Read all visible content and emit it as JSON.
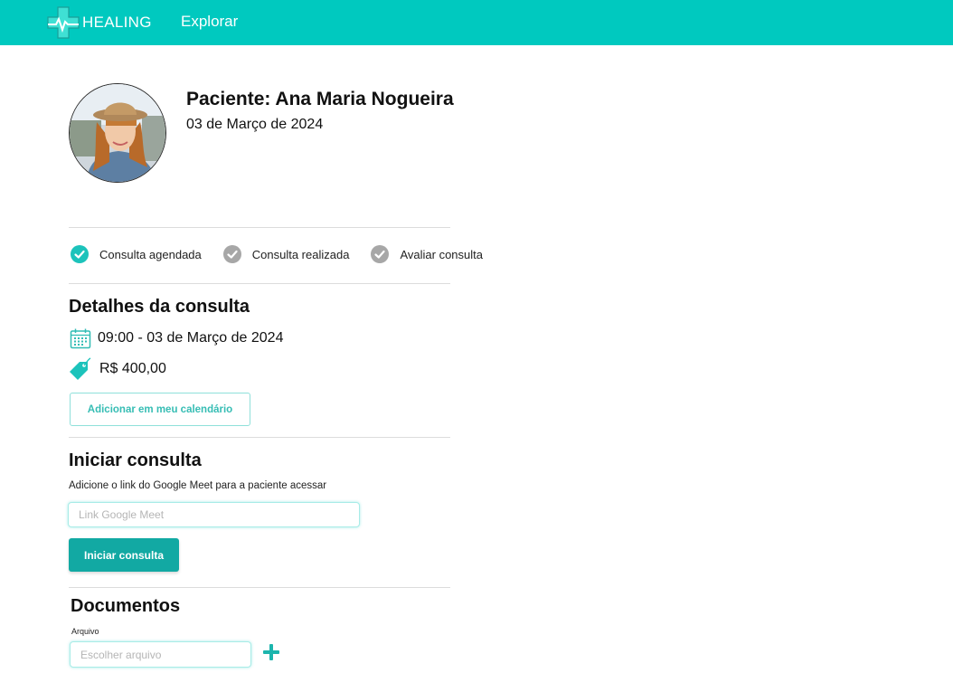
{
  "header": {
    "brand": "HEALING",
    "nav": [
      "Explorar"
    ]
  },
  "patient": {
    "name": "Paciente: Ana Maria Nogueira",
    "date": "03 de Março de 2024"
  },
  "status_steps": [
    {
      "label": "Consulta agendada",
      "state": "done"
    },
    {
      "label": "Consulta realizada",
      "state": "pending"
    },
    {
      "label": "Avaliar consulta",
      "state": "pending"
    }
  ],
  "details": {
    "title": "Detalhes da consulta",
    "datetime": "09:00 - 03 de Março de 2024",
    "price": "R$ 400,00",
    "add_calendar_label": "Adicionar em meu calendário"
  },
  "start": {
    "title": "Iniciar consulta",
    "helper": "Adicione o link do Google Meet para a paciente acessar",
    "meet_placeholder": "Link Google Meet",
    "meet_value": "",
    "button_label": "Iniciar consulta"
  },
  "documents": {
    "title": "Documentos",
    "file_label": "Arquivo",
    "file_placeholder": "Escolher arquivo"
  },
  "colors": {
    "brand": "#00c9bf",
    "primary_button": "#12a9a3",
    "done_step": "#1cc3bb",
    "pending_step": "#a7a7a7"
  },
  "icons": {
    "logo": "medical-cross-heartbeat-icon",
    "calendar": "calendar-icon",
    "price": "price-tag-icon",
    "step_done": "check-circle-icon",
    "step_pending": "check-circle-icon",
    "add": "plus-icon"
  }
}
